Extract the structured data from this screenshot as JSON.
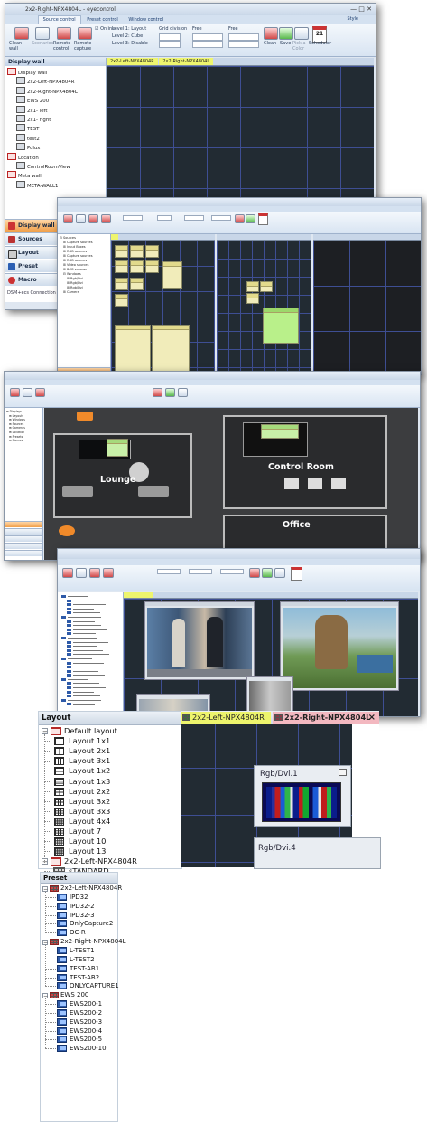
{
  "window1": {
    "title": "2x2-Right-NPX4804L - eyecontrol",
    "style_menu": "Style",
    "menu_tabs": [
      "Source control",
      "Preset control",
      "Window control"
    ],
    "ribbon": {
      "buttons": [
        "Clean wall",
        "Scenarios",
        "Remote control",
        "Remote capture"
      ],
      "online": "Online",
      "levels": [
        "Level 1: Layout",
        "Level 2: Cube",
        "Level 3: Disable"
      ],
      "grid_division": "Grid division",
      "free1": "Free",
      "free2": "Free",
      "right_buttons": [
        "Clean",
        "Save",
        "Pick a Color",
        "Scheduler"
      ],
      "calendar_day": "21"
    },
    "sidebar_header": "Display wall",
    "tree": [
      {
        "text": "Display wall",
        "level": 0
      },
      {
        "text": "2x2-Left-NPX4804R",
        "level": 1
      },
      {
        "text": "2x2-Right-NPX4804L",
        "level": 1
      },
      {
        "text": "EWS 200",
        "level": 1
      },
      {
        "text": "2x1- left",
        "level": 1
      },
      {
        "text": "2x1- right",
        "level": 1
      },
      {
        "text": "TEST",
        "level": 1
      },
      {
        "text": "test2",
        "level": 1
      },
      {
        "text": "Polux",
        "level": 1
      },
      {
        "text": "Location",
        "level": 0
      },
      {
        "text": "ControlRoomView",
        "level": 1
      },
      {
        "text": "Meta wall",
        "level": 0
      },
      {
        "text": "META-WALL1",
        "level": 1
      }
    ],
    "nav": [
      "Display wall",
      "Sources",
      "Layout",
      "Preset",
      "Macro"
    ],
    "status": "DSM+ecs Connection",
    "wall_tabs": [
      "2x2-Left-NPX4804R",
      "2x2-Right-NPX4804L"
    ]
  },
  "window3": {
    "rooms": [
      "Lounge",
      "Control Room",
      "Office"
    ]
  },
  "layout_panel": {
    "title": "Layout",
    "items": [
      {
        "text": "Default layout",
        "level": 0,
        "icon": "folder"
      },
      {
        "text": "Layout 1x1",
        "level": 1,
        "icon": "layout-1x1"
      },
      {
        "text": "Layout 2x1",
        "level": 1,
        "icon": "layout-2x1"
      },
      {
        "text": "Layout 3x1",
        "level": 1,
        "icon": "layout-3x1"
      },
      {
        "text": "Layout 1x2",
        "level": 1,
        "icon": "layout-1x2"
      },
      {
        "text": "Layout 1x3",
        "level": 1,
        "icon": "layout-1x3"
      },
      {
        "text": "Layout 2x2",
        "level": 1,
        "icon": "layout-2x2"
      },
      {
        "text": "Layout 3x2",
        "level": 1,
        "icon": "layout-3x2"
      },
      {
        "text": "Layout 3x3",
        "level": 1,
        "icon": "layout-3x3"
      },
      {
        "text": "Layout 4x4",
        "level": 1,
        "icon": "layout-4x4"
      },
      {
        "text": "Layout 7",
        "level": 1,
        "icon": "layout-7"
      },
      {
        "text": "Layout 10",
        "level": 1,
        "icon": "layout-10"
      },
      {
        "text": "Layout 13",
        "level": 1,
        "icon": "layout-13"
      },
      {
        "text": "2x2-Left-NPX4804R",
        "level": 0,
        "icon": "folder"
      },
      {
        "text": "sTANDARD",
        "level": 1,
        "icon": "grid"
      }
    ],
    "tabs": [
      {
        "label": "2x2-Left-NPX4804R",
        "active": false
      },
      {
        "label": "2x2-Right-NPX4804L",
        "active": true
      }
    ],
    "tab_close": "×",
    "windows": [
      "Rgb/Dvi.1",
      "Rgb/Dvi.4"
    ]
  },
  "preset_panel": {
    "title": "Preset",
    "groups": [
      {
        "name": "2x2-Left-NPX4804R",
        "items": [
          "IPD32",
          "IPD32-2",
          "IPD32-3",
          "OnlyCapture2",
          "OC-R"
        ]
      },
      {
        "name": "2x2-Right-NPX4804L",
        "items": [
          "L-TEST1",
          "L-TEST2",
          "TEST-AB1",
          "TEST-AB2",
          "ONLYCAPTURE1"
        ]
      },
      {
        "name": "EWS 200",
        "items": [
          "EWS200-1",
          "EWS200-2",
          "EWS200-3",
          "EWS200-4",
          "EWS200-5",
          "EWS200-10"
        ]
      }
    ]
  },
  "colors": {
    "wall_bg": "#222b33",
    "wall_grid": "#3e4e93",
    "tab_yellow": "#eef56e",
    "tab_pink": "#f2b1b9",
    "nav_active": "#f0a04a"
  }
}
